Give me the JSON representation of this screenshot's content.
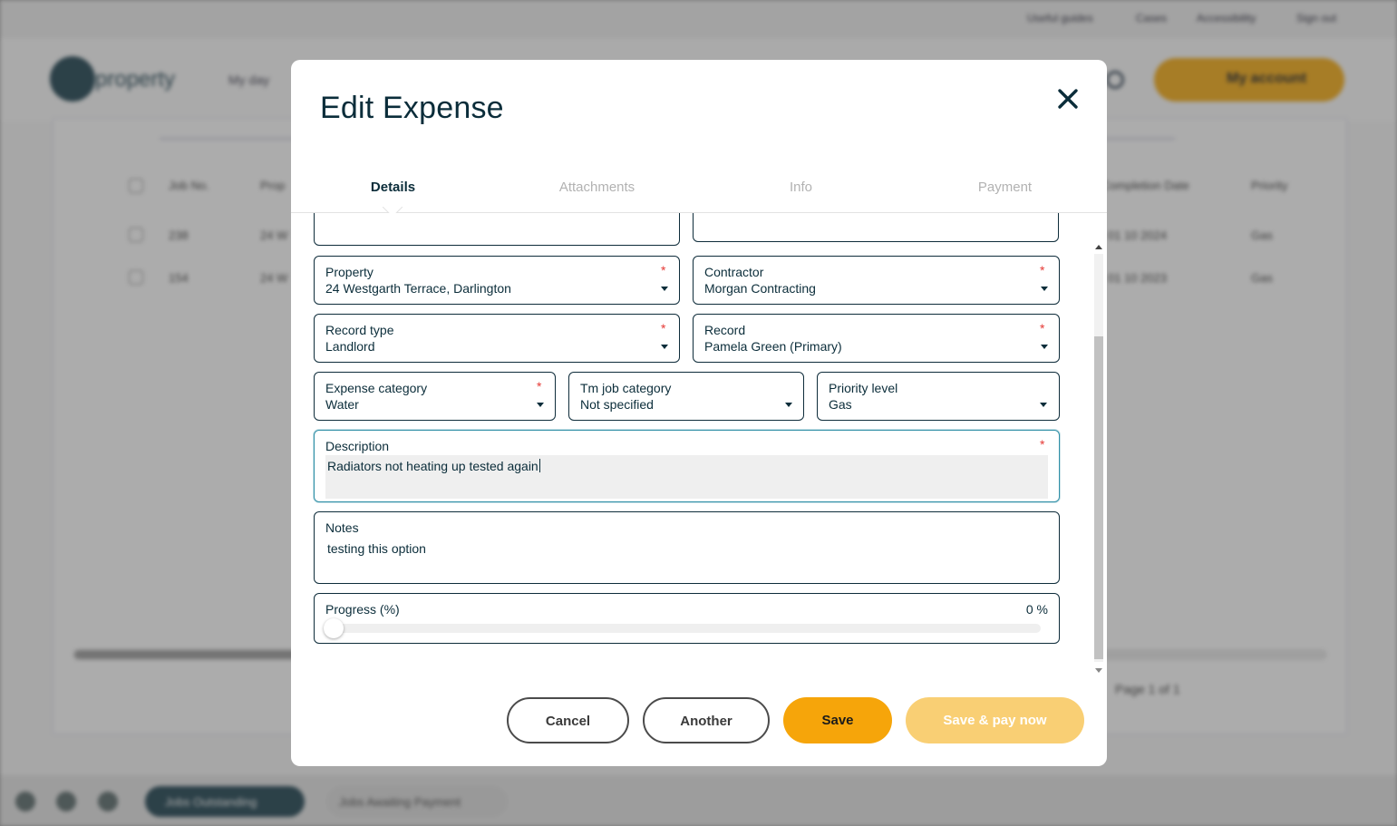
{
  "background": {
    "top_links": [
      "Useful guides",
      "Cases",
      "Accessibility",
      "Sign out"
    ],
    "logo_text": "property",
    "nav_item": "My day",
    "account_button": "My account",
    "table_headers": [
      "Job No.",
      "Prop",
      "Completion Date",
      "Priority"
    ],
    "rows": [
      {
        "job": "238",
        "prop": "24 W",
        "date": "01 10 2024",
        "priority": "Gas"
      },
      {
        "job": "154",
        "prop": "24 W",
        "date": "01 10 2023",
        "priority": "Gas"
      }
    ],
    "pager": "Page 1 of 1",
    "bottom_pills": [
      "Jobs Outstanding",
      "Jobs Awaiting Payment"
    ]
  },
  "modal": {
    "title": "Edit Expense",
    "tabs": [
      {
        "label": "Details",
        "active": true
      },
      {
        "label": "Attachments",
        "active": false
      },
      {
        "label": "Info",
        "active": false
      },
      {
        "label": "Payment",
        "active": false
      }
    ],
    "fields": {
      "property": {
        "label": "Property",
        "value": "24 Westgarth Terrace, Darlington",
        "required": true
      },
      "contractor": {
        "label": "Contractor",
        "value": "Morgan Contracting",
        "required": true
      },
      "record_type": {
        "label": "Record type",
        "value": "Landlord",
        "required": true
      },
      "record": {
        "label": "Record",
        "value": "Pamela Green (Primary)",
        "required": true
      },
      "expense_category": {
        "label": "Expense category",
        "value": "Water",
        "required": true
      },
      "tm_job_category": {
        "label": "Tm job category",
        "value": "Not specified",
        "required": false
      },
      "priority_level": {
        "label": "Priority level",
        "value": "Gas",
        "required": false
      },
      "description": {
        "label": "Description",
        "value": "Radiators not heating up tested again",
        "required": true
      },
      "notes": {
        "label": "Notes",
        "value": "testing this option"
      },
      "progress": {
        "label": "Progress (%)",
        "value": 0,
        "display": "0 %"
      }
    },
    "required_mark": "*",
    "buttons": {
      "cancel": "Cancel",
      "another": "Another",
      "save": "Save",
      "save_pay": "Save & pay now"
    },
    "colors": {
      "primary": "#f6a50a",
      "primary_light": "#f9cf74",
      "text": "#0b2d3a",
      "required": "#e53935"
    }
  }
}
